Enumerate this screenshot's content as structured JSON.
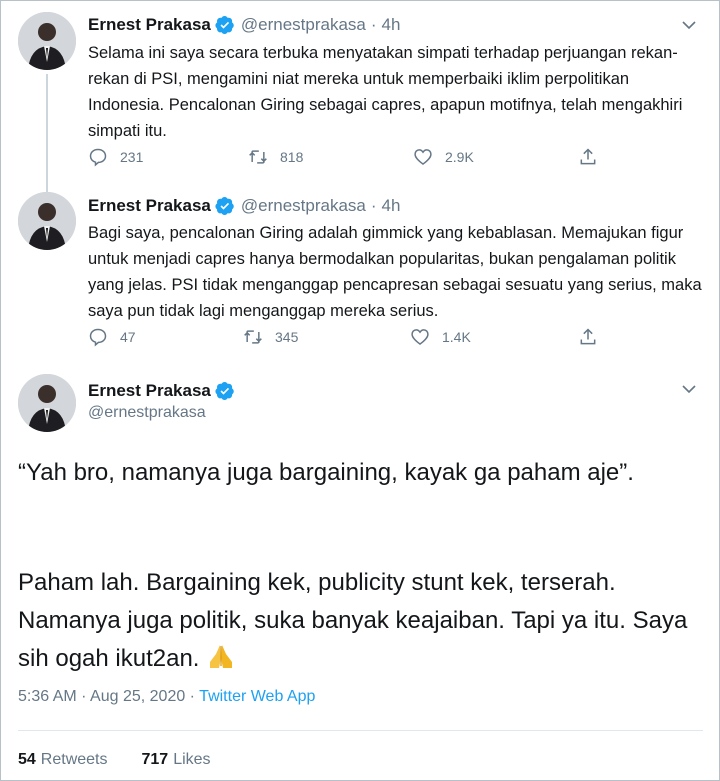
{
  "tweets": [
    {
      "name": "Ernest Prakasa",
      "handle": "@ernestprakasa",
      "time": "4h",
      "text": "Selama ini saya secara terbuka menyatakan simpati terhadap perjuangan rekan-rekan di PSI, mengamini niat mereka untuk memperbaiki iklim perpolitikan Indonesia. Pencalonan Giring sebagai capres, apapun motifnya, telah mengakhiri simpati itu.",
      "replies": "231",
      "retweets": "818",
      "likes": "2.9K"
    },
    {
      "name": "Ernest Prakasa",
      "handle": "@ernestprakasa",
      "time": "4h",
      "text": "Bagi saya, pencalonan Giring adalah gimmick yang kebablasan. Memajukan figur untuk menjadi capres hanya bermodalkan popularitas, bukan pengalaman politik yang jelas. PSI tidak menganggap pencapresan sebagai sesuatu yang serius, maka saya pun tidak lagi menganggap mereka serius.",
      "replies": "47",
      "retweets": "345",
      "likes": "1.4K"
    }
  ],
  "main": {
    "name": "Ernest Prakasa",
    "handle": "@ernestprakasa",
    "paragraph1": "“Yah bro, namanya juga bargaining, kayak ga paham aje”.",
    "paragraph2": "Paham lah. Bargaining kek, publicity stunt kek, terserah. Namanya juga politik, suka banyak keajaiban. Tapi ya itu. Saya sih ogah ikut2an.",
    "emoji": "folded-hands-emoji",
    "timestamp": "5:36 AM · Aug 25, 2020",
    "separator": " · ",
    "app": "Twitter Web App",
    "retweets_count": "54",
    "retweets_label": "Retweets",
    "likes_count": "717",
    "likes_label": "Likes"
  },
  "colors": {
    "accent": "#1da1f2",
    "muted": "#657786",
    "text": "#14171a"
  },
  "icons": [
    "avatar",
    "verified-badge-icon",
    "chevron-down-icon",
    "reply-icon",
    "retweet-icon",
    "like-icon",
    "share-icon"
  ]
}
